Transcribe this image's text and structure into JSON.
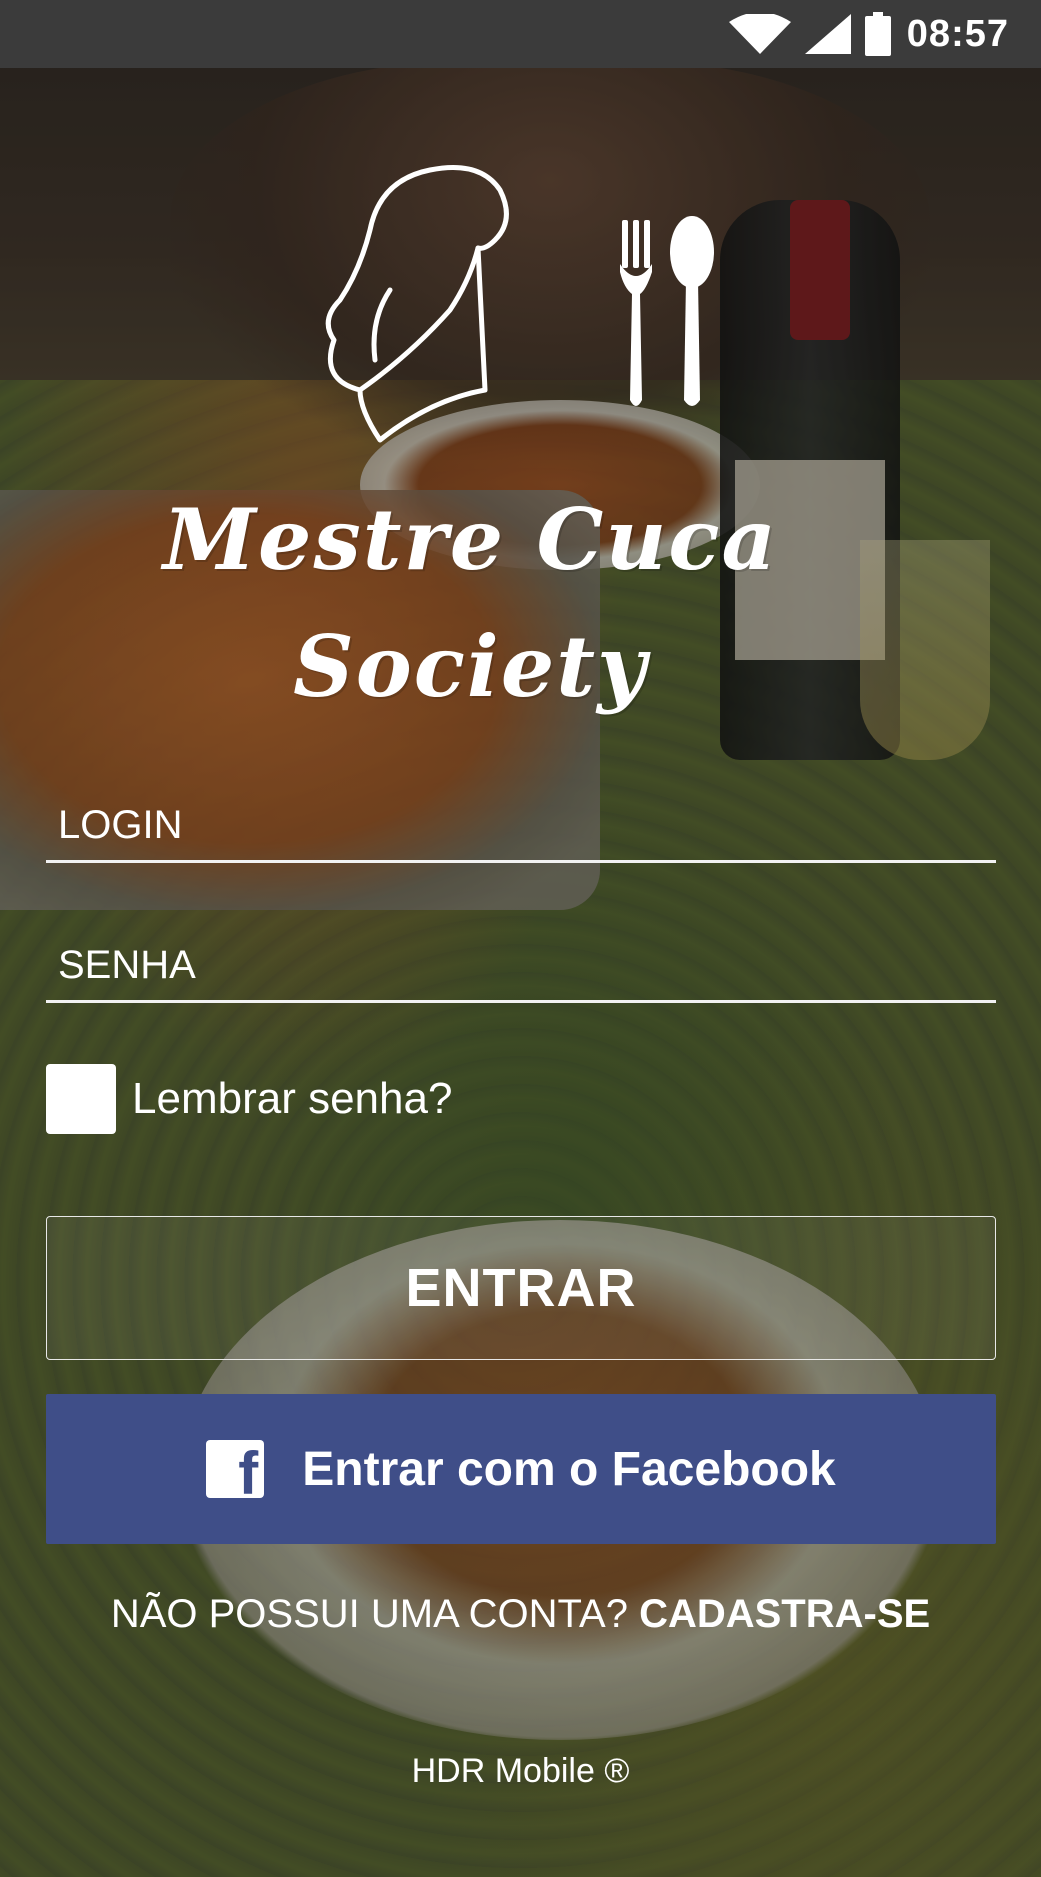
{
  "status_bar": {
    "time": "08:57",
    "icons": [
      "wifi-icon",
      "cellular-signal-icon",
      "battery-icon"
    ]
  },
  "brand": {
    "line1": "Mestre Cuca",
    "line2": "Society",
    "logo_icons": [
      "chef-hat-icon",
      "fork-icon",
      "spoon-icon"
    ]
  },
  "form": {
    "login_placeholder": "LOGIN",
    "senha_placeholder": "SENHA",
    "remember_label": "Lembrar senha?",
    "remember_checked": false
  },
  "actions": {
    "entrar_label": "ENTRAR",
    "facebook_label": "Entrar com o Facebook",
    "facebook_icon": "facebook-icon",
    "facebook_color": "#3f4e88"
  },
  "signup": {
    "prompt": "NÃO POSSUI UMA CONTA? ",
    "link": "CADASTRA-SE"
  },
  "footer": {
    "text": "HDR Mobile ®"
  }
}
